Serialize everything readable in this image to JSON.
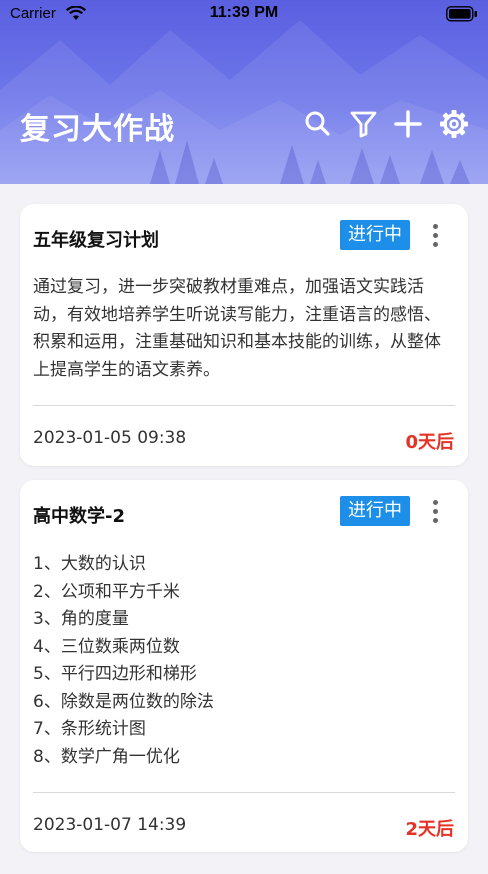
{
  "status_bar": {
    "carrier": "Carrier",
    "time": "11:39 PM"
  },
  "header": {
    "title": "复习大作战",
    "icons": [
      "search-icon",
      "filter-icon",
      "add-icon",
      "settings-icon"
    ]
  },
  "colors": {
    "header_gradient_top": "#5a5fe0",
    "header_gradient_bottom": "#8f98f1",
    "badge": "#1e8fe8",
    "countdown": "#e53226",
    "background": "#f2f2f7"
  },
  "plans": [
    {
      "title": "五年级复习计划",
      "status": "进行中",
      "description": "通过复习，进一步突破教材重难点，加强语文实践活动，有效地培养学生听说读写能力，注重语言的感悟、积累和运用，注重基础知识和基本技能的训练，从整体上提高学生的语文素养。",
      "date": "2023-01-05 09:38",
      "countdown": "0天后"
    },
    {
      "title": "高中数学-2",
      "status": "进行中",
      "items": [
        "1、大数的认识",
        "2、公项和平方千米",
        "3、角的度量",
        "4、三位数乘两位数",
        "5、平行四边形和梯形",
        "6、除数是两位数的除法",
        "7、条形统计图",
        "8、数学广角一优化"
      ],
      "date": "2023-01-07 14:39",
      "countdown": "2天后"
    }
  ]
}
